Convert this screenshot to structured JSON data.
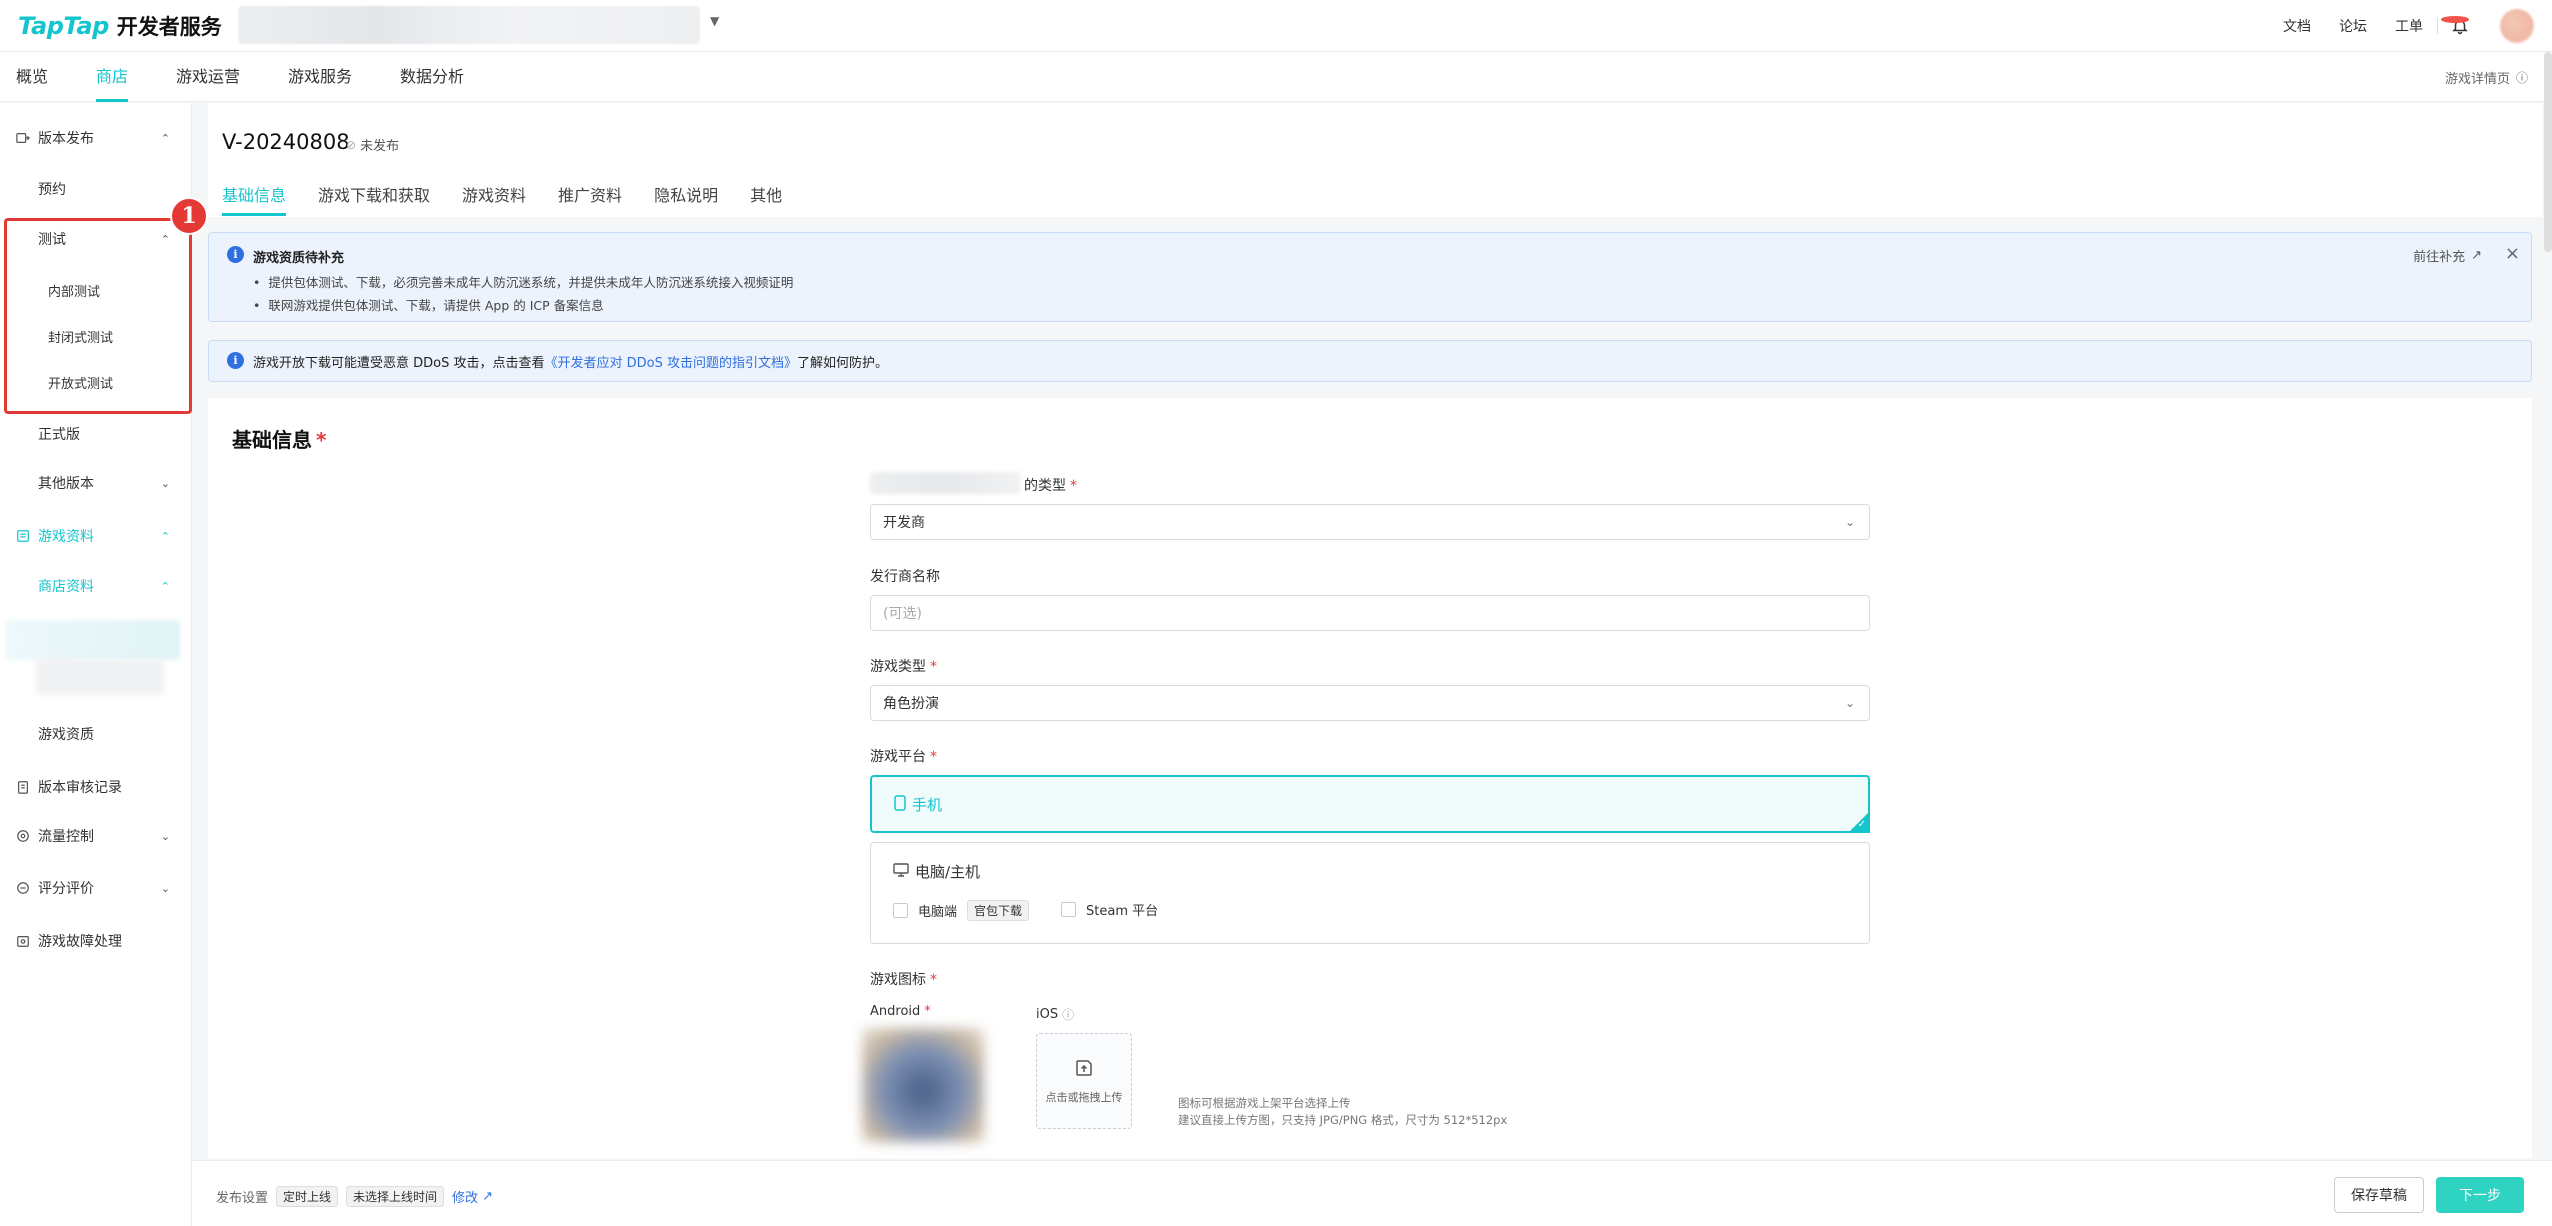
{
  "topbar": {
    "logo_tap": "TapTap",
    "logo_service": "开发者服务",
    "links": [
      "文档",
      "论坛",
      "工单"
    ]
  },
  "nav": {
    "tabs": [
      "概览",
      "商店",
      "游戏运营",
      "游戏服务",
      "数据分析"
    ],
    "active": "商店",
    "detail_link": "游戏详情页"
  },
  "sidebar": {
    "items": [
      {
        "label": "版本发布",
        "icon": "release-icon"
      },
      {
        "label": "预约"
      },
      {
        "label": "测试"
      },
      {
        "label": "内部测试"
      },
      {
        "label": "封闭式测试"
      },
      {
        "label": "开放式测试"
      },
      {
        "label": "正式版"
      },
      {
        "label": "其他版本"
      },
      {
        "label": "游戏资料",
        "icon": "book-icon"
      },
      {
        "label": "商店资料"
      },
      {
        "label": "游戏资质"
      },
      {
        "label": "版本审核记录",
        "icon": "clipboard-icon"
      },
      {
        "label": "流量控制",
        "icon": "traffic-icon"
      },
      {
        "label": "评分评价",
        "icon": "comment-icon"
      },
      {
        "label": "游戏故障处理",
        "icon": "repair-icon"
      }
    ],
    "annotation_number": "1"
  },
  "header": {
    "version": "V-20240808",
    "status": "未发布",
    "tabs": [
      "基础信息",
      "游戏下载和获取",
      "游戏资料",
      "推广资料",
      "隐私说明",
      "其他"
    ]
  },
  "alerts": {
    "notice_title": "游戏资质待补充",
    "notice_items": [
      "提供包体测试、下载，必须完善未成年人防沉迷系统，并提供未成年人防沉迷系统接入视频证明",
      "联网游戏提供包体测试、下载，请提供 App 的 ICP 备案信息"
    ],
    "notice_action": "前往补充",
    "ddos_prefix": "游戏开放下载可能遭受恶意 DDoS 攻击，点击查看",
    "ddos_link": "《开发者应对 DDoS 攻击问题的指引文档》",
    "ddos_suffix": "了解如何防护。"
  },
  "form": {
    "section_title": "基础信息",
    "type_label_suffix": "的类型",
    "type_value": "开发商",
    "publisher_label": "发行商名称",
    "publisher_placeholder": "(可选)",
    "genre_label": "游戏类型",
    "genre_value": "角色扮演",
    "platform_label": "游戏平台",
    "platform_mobile": "手机",
    "platform_pc": "电脑/主机",
    "pc_option": "电脑端",
    "pc_option_tag": "官包下载",
    "steam_option": "Steam 平台",
    "icon_label": "游戏图标",
    "android_label": "Android",
    "ios_label": "iOS",
    "upload_text": "点击或拖拽上传",
    "hint_line1": "图标可根据游戏上架平台选择上传",
    "hint_line2": "建议直接上传方图，只支持 JPG/PNG 格式，尺寸为 512*512px"
  },
  "footer": {
    "publish_label": "发布设置",
    "tag1": "定时上线",
    "tag2": "未选择上线时间",
    "edit": "修改",
    "save_draft": "保存草稿",
    "next": "下一步"
  },
  "colors": {
    "accent": "#15c5ce",
    "annotation": "#e53935",
    "info": "#2f6fe0"
  }
}
